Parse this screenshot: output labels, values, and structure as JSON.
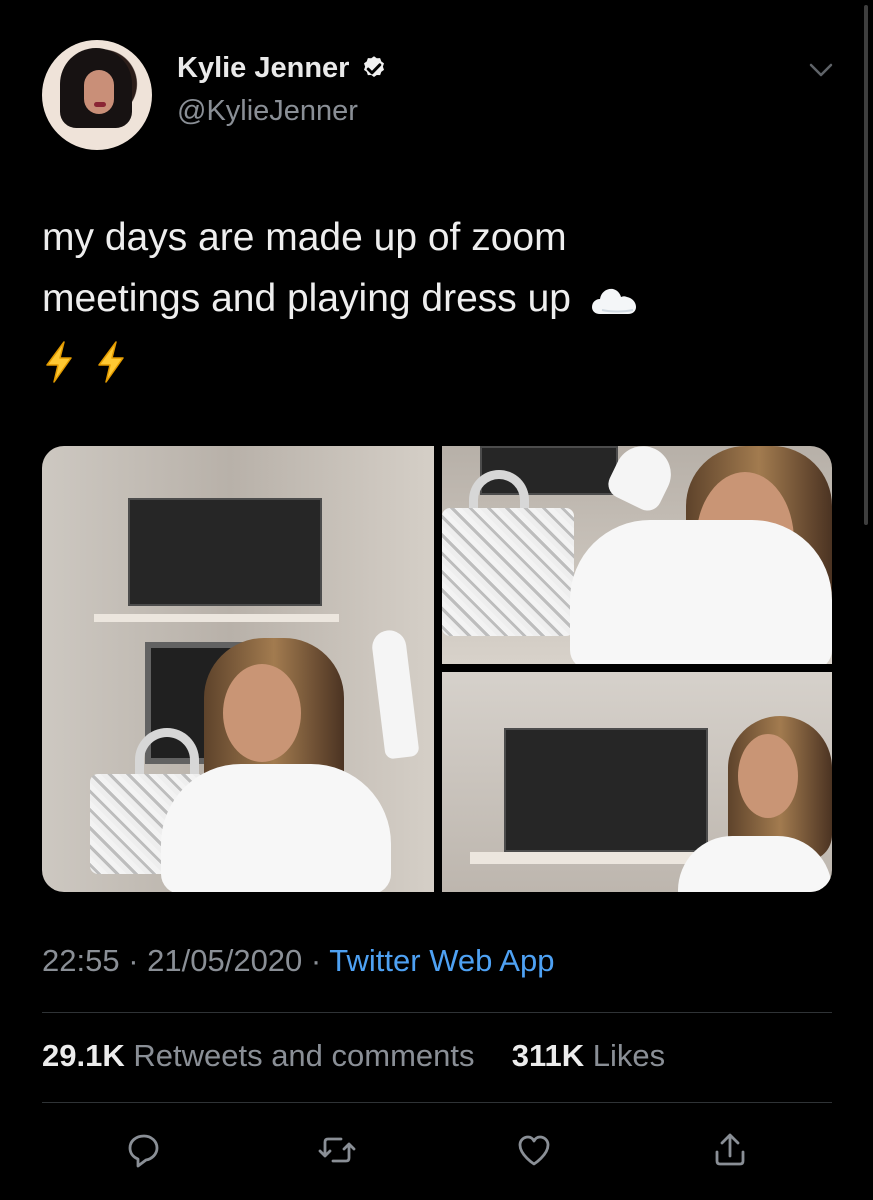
{
  "author": {
    "display_name": "Kylie Jenner",
    "handle": "@KylieJenner",
    "verified_icon": "verified-badge-icon"
  },
  "tweet": {
    "text_line_1": "my days are made up of zoom",
    "text_line_2": "meetings and playing dress up",
    "emojis": [
      "cloud",
      "high-voltage",
      "high-voltage"
    ]
  },
  "meta": {
    "time": "22:55",
    "separator_1": " · ",
    "date": "21/05/2020",
    "separator_2": " · ",
    "source": "Twitter Web App"
  },
  "stats": {
    "retweets_count": "29.1K",
    "retweets_label": "Retweets and comments",
    "likes_count": "311K",
    "likes_label": "Likes"
  },
  "actions": {
    "reply_icon": "reply-icon",
    "retweet_icon": "retweet-icon",
    "like_icon": "heart-icon",
    "share_icon": "share-icon"
  },
  "colors": {
    "background": "#000000",
    "primary_text": "#eeeeee",
    "secondary_text": "#8a8f96",
    "link": "#4ea1f3",
    "divider": "#2f3336"
  }
}
